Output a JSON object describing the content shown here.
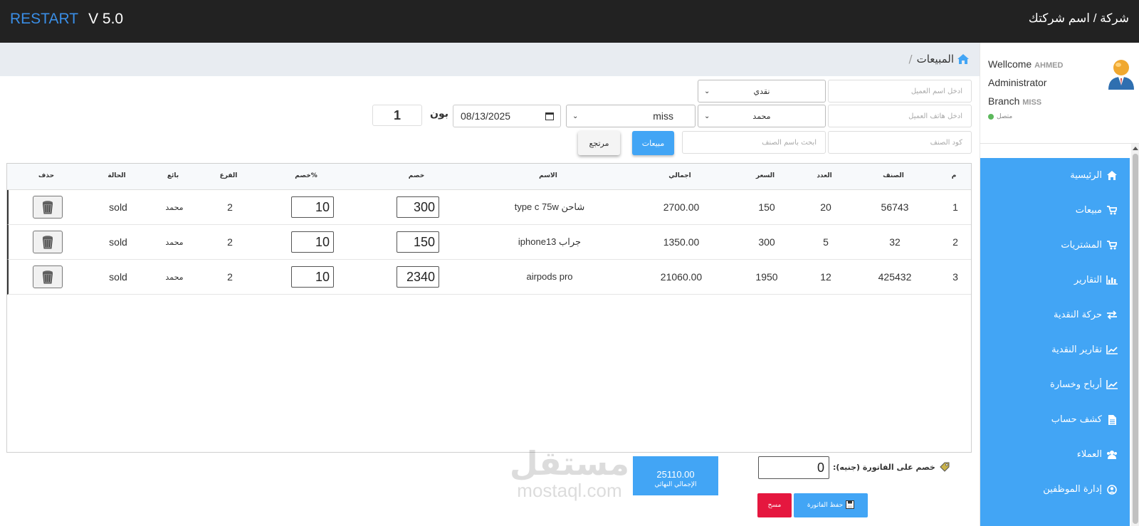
{
  "brand": {
    "name": "RESTART",
    "version": "V 5.0"
  },
  "company": {
    "label": "شركة /",
    "name": "اسم شركتك"
  },
  "user": {
    "welcome_label": "Wellcome",
    "welcome_name": "AHMED",
    "role": "Administrator",
    "branch_label": "Branch",
    "branch_name": "MISS",
    "status": "متصل"
  },
  "breadcrumb": {
    "current": "المبيعات",
    "separator": "/"
  },
  "form": {
    "customer_name_placeholder": "ادخل اسم العميل",
    "payment_type": "نقدي",
    "customer_phone_placeholder": "ادخل هاتف العميل",
    "seller": "محمد",
    "branch": "miss",
    "date": "08/13/2025",
    "bon_label": "بون",
    "bon_number": "1",
    "item_code_placeholder": "كود الصنف",
    "item_name_placeholder": "ابحث باسم الصنف",
    "sales_button": "مبيعات",
    "return_button": "مرتجع"
  },
  "table": {
    "headers": {
      "num": "م",
      "item": "الصنف",
      "qty": "العدد",
      "price": "السعر",
      "total": "اجمالي",
      "name": "الاسم",
      "discount": "خصم",
      "discount_pct": "خصم%",
      "branch": "الفرع",
      "seller": "بائع",
      "status": "الحالة",
      "delete": "حذف"
    },
    "rows": [
      {
        "num": "1",
        "item": "56743",
        "qty": "20",
        "price": "150",
        "total": "2700.00",
        "name": "شاحن type c 75w",
        "discount": "300",
        "discount_pct": "10",
        "branch": "2",
        "seller": "محمد",
        "status": "sold"
      },
      {
        "num": "2",
        "item": "32",
        "qty": "5",
        "price": "300",
        "total": "1350.00",
        "name": "جراب iphone13",
        "discount": "150",
        "discount_pct": "10",
        "branch": "2",
        "seller": "محمد",
        "status": "sold"
      },
      {
        "num": "3",
        "item": "425432",
        "qty": "12",
        "price": "1950",
        "total": "21060.00",
        "name": "airpods pro",
        "discount": "2340",
        "discount_pct": "10",
        "branch": "2",
        "seller": "محمد",
        "status": "sold"
      }
    ]
  },
  "footer": {
    "grand_total": "25110.00",
    "grand_total_label": "الإجمالي النهائي",
    "invoice_discount_label": "خصم على الفاتورة (جنيه):",
    "invoice_discount": "0",
    "save_button": "حفظ الفاتورة",
    "clear_button": "مسح"
  },
  "sidebar": {
    "items": [
      {
        "label": "الرئيسية",
        "icon": "home-icon"
      },
      {
        "label": "مبيعات",
        "icon": "cart-icon"
      },
      {
        "label": "المشتريات",
        "icon": "cart-icon"
      },
      {
        "label": "التقارير",
        "icon": "bar-chart-icon"
      },
      {
        "label": "حركة النقدية",
        "icon": "transfer-icon"
      },
      {
        "label": "تقارير النقدية",
        "icon": "line-chart-icon"
      },
      {
        "label": "أرباح وخسارة",
        "icon": "line-chart-icon"
      },
      {
        "label": "كشف حساب",
        "icon": "document-icon"
      },
      {
        "label": "العملاء",
        "icon": "users-icon"
      },
      {
        "label": "إدارة الموظفين",
        "icon": "user-circle-icon"
      }
    ]
  },
  "watermark": {
    "arabic": "مستقل",
    "latin": "mostaql.com"
  },
  "colors": {
    "topbar": "#222222",
    "accent": "#42a5f5",
    "brand_blue": "#3a8ee6",
    "danger": "#e5173f",
    "online": "#5cb85c"
  }
}
